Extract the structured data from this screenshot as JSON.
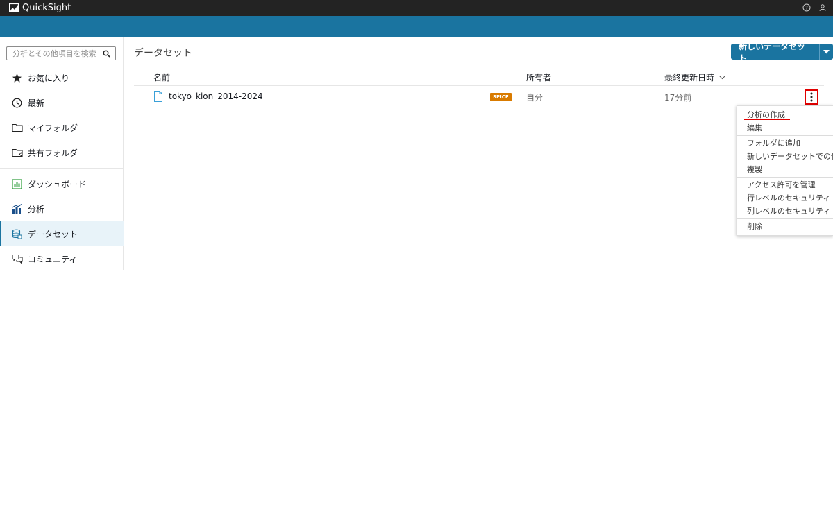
{
  "app": {
    "title": "QuickSight"
  },
  "sidebar": {
    "search_placeholder": "分析とその他項目を検索",
    "items": [
      {
        "label": "お気に入り",
        "icon": "star-icon"
      },
      {
        "label": "最新",
        "icon": "clock-icon"
      },
      {
        "label": "マイフォルダ",
        "icon": "folder-icon"
      },
      {
        "label": "共有フォルダ",
        "icon": "shared-folder-icon"
      },
      {
        "label": "ダッシュボード",
        "icon": "dashboard-icon"
      },
      {
        "label": "分析",
        "icon": "analysis-icon"
      },
      {
        "label": "データセット",
        "icon": "dataset-icon",
        "active": true
      },
      {
        "label": "コミュニティ",
        "icon": "community-icon"
      }
    ]
  },
  "main": {
    "title": "データセット",
    "new_button": "新しいデータセット",
    "columns": {
      "name": "名前",
      "owner": "所有者",
      "updated": "最終更新日時"
    },
    "rows": [
      {
        "name": "tokyo_kion_2014-2024",
        "badge": "SPICE",
        "owner": "自分",
        "updated": "17分前"
      }
    ]
  },
  "context_menu": {
    "items": [
      "分析の作成",
      "編集",
      "フォルダに追加",
      "新しいデータセットでの使用",
      "複製",
      "アクセス許可を管理",
      "行レベルのセキュリティ",
      "列レベルのセキュリティ",
      "削除"
    ]
  },
  "colors": {
    "topbar": "#232323",
    "brand_blue": "#1a74a0",
    "spice": "#d97b00",
    "highlight": "#e00000"
  }
}
